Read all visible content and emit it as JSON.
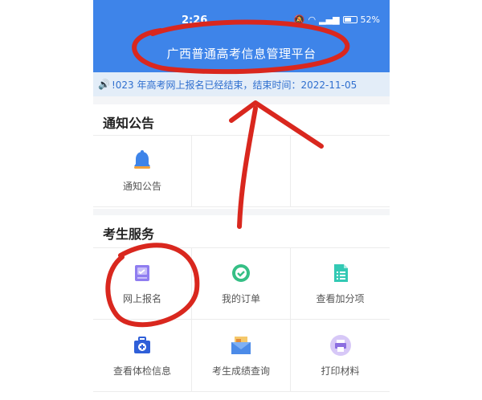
{
  "status": {
    "time": "2:26",
    "battery": "52%"
  },
  "app": {
    "title": "广西普通高考信息管理平台"
  },
  "notice": {
    "text": "!023 年高考网上报名已经结束，结束时间：2022-11-05"
  },
  "sections": {
    "notices": {
      "title": "通知公告",
      "items": [
        {
          "label": "通知公告",
          "icon": "bell-icon"
        }
      ]
    },
    "services": {
      "title": "考生服务",
      "items": [
        {
          "label": "网上报名",
          "icon": "registration-icon"
        },
        {
          "label": "我的订单",
          "icon": "order-check-icon"
        },
        {
          "label": "查看加分项",
          "icon": "document-list-icon"
        },
        {
          "label": "查看体检信息",
          "icon": "medical-kit-icon"
        },
        {
          "label": "考生成绩查询",
          "icon": "score-mail-icon"
        },
        {
          "label": "打印材料",
          "icon": "printer-icon"
        }
      ]
    }
  },
  "colors": {
    "primary": "#3e84e9",
    "annotation": "#d9271e"
  }
}
